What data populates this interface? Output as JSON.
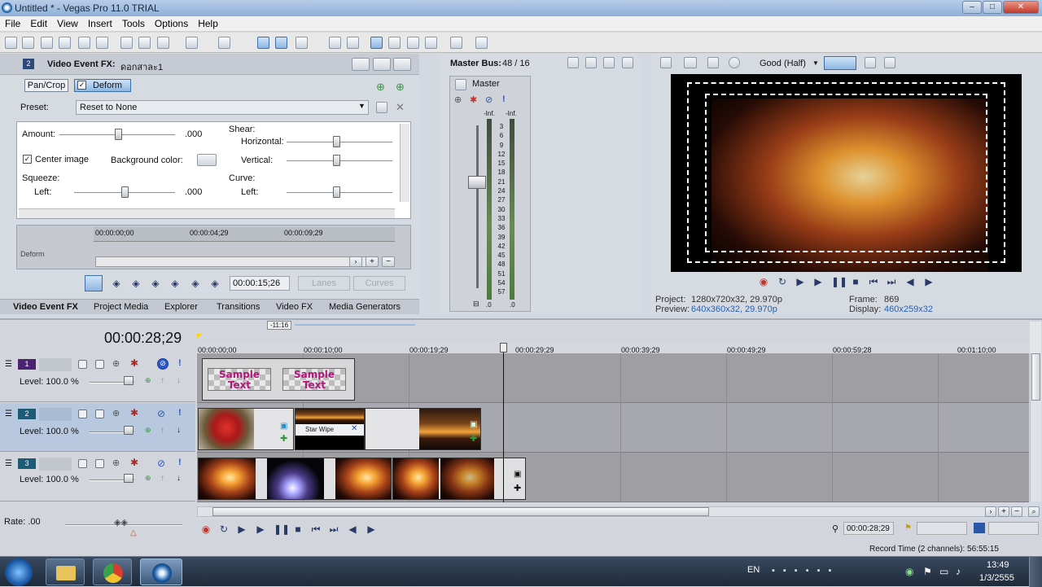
{
  "window": {
    "title": "Untitled * - Vegas Pro 11.0 TRIAL"
  },
  "menu": [
    "File",
    "Edit",
    "View",
    "Insert",
    "Tools",
    "Options",
    "Help"
  ],
  "fx": {
    "header_title": "Video Event FX:",
    "header_name": "ดอกสาละ1",
    "chain": [
      "Pan/Crop",
      "Deform"
    ],
    "preset_label": "Preset:",
    "preset_value": "Reset to None",
    "amount_label": "Amount:",
    "amount_value": ".000",
    "center_image": "Center image",
    "bg_color_label": "Background color:",
    "squeeze_label": "Squeeze:",
    "left_label": "Left:",
    "left_value": ".000",
    "shear_label": "Shear:",
    "horizontal_label": "Horizontal:",
    "vertical_label": "Vertical:",
    "curve_label": "Curve:",
    "curve_left_label": "Left:",
    "kf_times": [
      "00:00:00;00",
      "00:00:04;29",
      "00:00:09;29"
    ],
    "kf_row": "Deform",
    "kf_time": "00:00:15;26",
    "lanes_btn": "Lanes",
    "curves_btn": "Curves"
  },
  "tabs": [
    "Video Event FX",
    "Project Media",
    "Explorer",
    "Transitions",
    "Video FX",
    "Media Generators"
  ],
  "master": {
    "title": "Master Bus:",
    "value": "48 / 16",
    "label": "Master",
    "inf_left": "-Inf.",
    "inf_right": "-Inf.",
    "scale": [
      "3",
      "6",
      "9",
      "12",
      "15",
      "18",
      "21",
      "24",
      "27",
      "30",
      "33",
      "36",
      "39",
      "42",
      "45",
      "48",
      "51",
      "54",
      "57"
    ],
    "bottom_left": ".0",
    "bottom_right": ".0"
  },
  "preview": {
    "quality": "Good (Half)",
    "project_label": "Project:",
    "project_value": "1280x720x32, 29.970p",
    "preview_label": "Preview:",
    "preview_value": "640x360x32, 29.970p",
    "frame_label": "Frame:",
    "frame_value": "869",
    "display_label": "Display:",
    "display_value": "460x259x32"
  },
  "timeline": {
    "time": "00:00:28;29",
    "marker": "-11:16",
    "ruler": [
      "00:00:00;00",
      "00:00:10;00",
      "00:00:19;29",
      "00:00:29;29",
      "00:00:39;29",
      "00:00:49;29",
      "00:00:59;28",
      "00:01:10;00"
    ],
    "tracks": [
      {
        "num": "1",
        "level": "Level: 100.0 %"
      },
      {
        "num": "2",
        "level": "Level: 100.0 %"
      },
      {
        "num": "3",
        "level": "Level: 100.0 %"
      }
    ],
    "sticker_text": "Sample Text",
    "transition": "Star Wipe",
    "rate": "Rate: .00",
    "bottom_time": "00:00:28;29",
    "record_time": "Record Time (2 channels): 56:55:15"
  },
  "taskbar": {
    "lang": "EN",
    "time": "13:49",
    "date": "1/3/2555"
  }
}
